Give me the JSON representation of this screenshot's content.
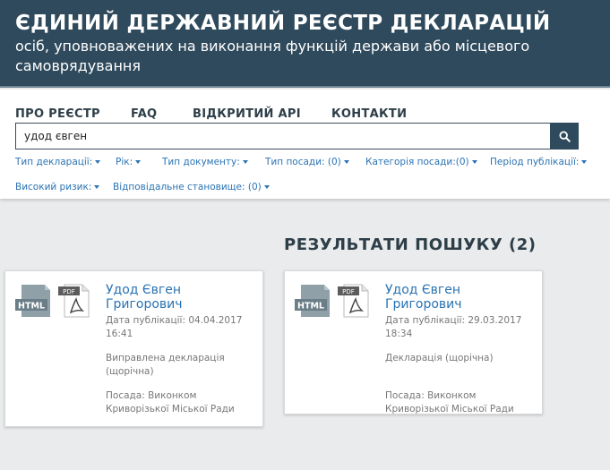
{
  "header": {
    "title": "ЄДИНИЙ ДЕРЖАВНИЙ РЕЄСТР ДЕКЛАРАЦІЙ",
    "subtitle": "осіб, уповноважених на виконання функцій держави або місцевого самоврядування"
  },
  "nav": {
    "items": [
      "ПРО РЕЄСТР",
      "FAQ",
      "ВІДКРИТИЙ API",
      "КОНТАКТИ"
    ]
  },
  "search": {
    "value": "удод євген",
    "button_icon": "search-icon"
  },
  "filters": [
    "Тип декларації:",
    "Рік:",
    "Тип документу:",
    "Тип посади: (0)",
    "Категорія посади:(0)",
    "Період публікації:",
    "Високий ризик:",
    "Відповідальне становище: (0)"
  ],
  "results": {
    "title": "РЕЗУЛЬТАТИ ПОШУКУ (2)",
    "items": [
      {
        "html_label": "HTML",
        "pdf_label": "PDF",
        "name": "Удод Євген Григорович",
        "published": "Дата публікації: 04.04.2017 16:41",
        "doc_type": "Виправлена декларація (щорічна)",
        "position": "Посада: Виконком Криворізької Міської Ради"
      },
      {
        "html_label": "HTML",
        "pdf_label": "PDF",
        "name": "Удод Євген Григорович",
        "published": "Дата публікації: 29.03.2017 18:34",
        "doc_type": "Декларація (щорічна)",
        "position": "Посада: Виконком Криворізької Міської Ради"
      }
    ]
  },
  "colors": {
    "header_bg": "#2f4a5c",
    "link": "#2a73b3",
    "page_bg": "#e9ebec"
  }
}
